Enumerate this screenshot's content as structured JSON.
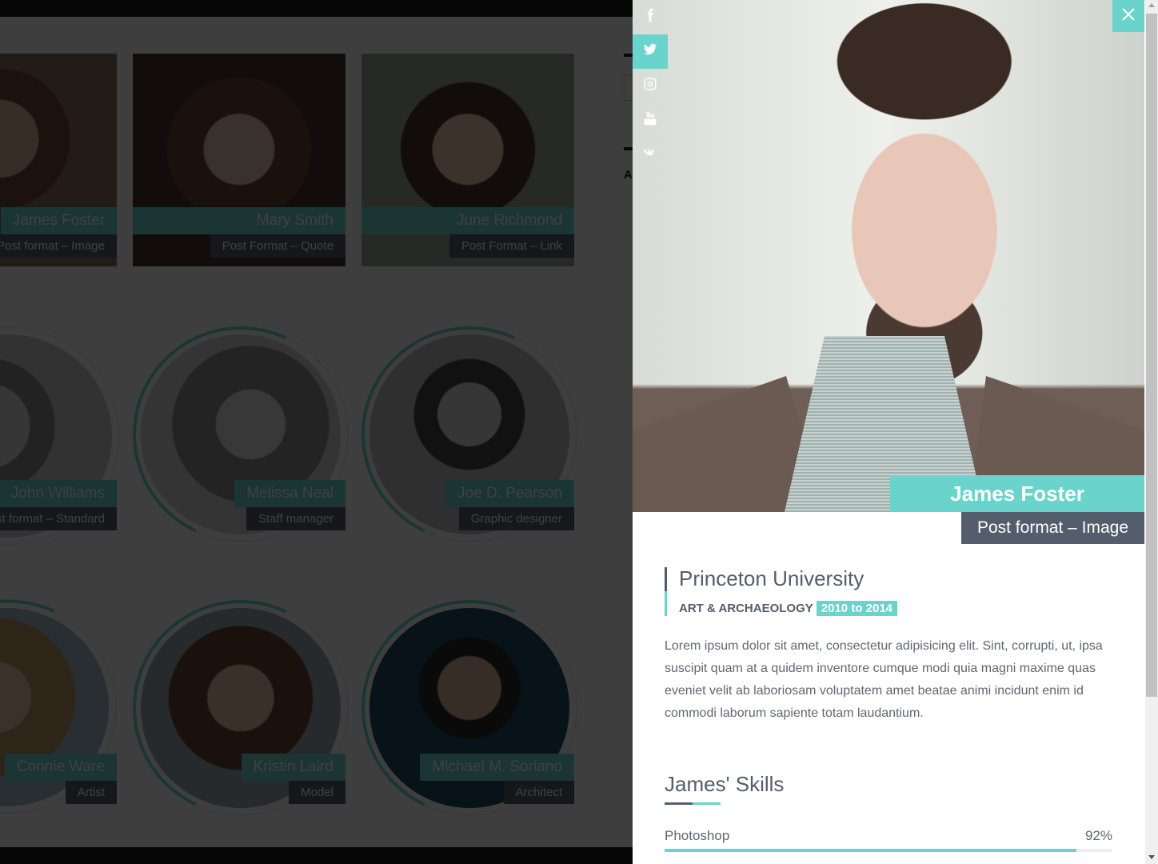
{
  "background_page": {
    "cards": [
      {
        "name": "James Foster",
        "role": "Post format – Image",
        "shape": "square"
      },
      {
        "name": "Mary Smith",
        "role": "Post Format – Quote",
        "shape": "square"
      },
      {
        "name": "June Richmond",
        "role": "Post Format – Link",
        "shape": "square"
      },
      {
        "name": "John Williams",
        "role": "Post format – Standard",
        "shape": "round"
      },
      {
        "name": "Melissa Neal",
        "role": "Staff manager",
        "shape": "round"
      },
      {
        "name": "Joe D. Pearson",
        "role": "Graphic designer",
        "shape": "round"
      },
      {
        "name": "Connie Ware",
        "role": "Artist",
        "shape": "round"
      },
      {
        "name": "Kristin Laird",
        "role": "Model",
        "shape": "round"
      },
      {
        "name": "Michael M. Soriano",
        "role": "Architect",
        "shape": "round"
      }
    ],
    "sidebar_letter": "A"
  },
  "panel": {
    "social": [
      {
        "icon": "facebook-icon",
        "glyph": "f",
        "active": false
      },
      {
        "icon": "twitter-icon",
        "glyph": "",
        "active": true
      },
      {
        "icon": "instagram-icon",
        "glyph": "",
        "active": false
      },
      {
        "icon": "youtube-icon",
        "glyph": "You Tube",
        "active": false
      },
      {
        "icon": "vk-icon",
        "glyph": "vk",
        "active": false
      }
    ],
    "close_icon": "close-icon",
    "name": "James Foster",
    "role": "Post format – Image",
    "education": {
      "school": "Princeton University",
      "field": "ART & ARCHAEOLOGY",
      "years": "2010 to 2014"
    },
    "bio": "Lorem ipsum dolor sit amet, consectetur adipisicing elit. Sint, corrupti, ut, ipsa suscipit quam at a quidem inventore cumque modi quia magni maxime quas eveniet velit ab laboriosam voluptatem amet beatae animi incidunt enim id commodi laborum sapiente totam laudantium.",
    "skills_title": "James' Skills",
    "skills": [
      {
        "label": "Photoshop",
        "percent_label": "92%",
        "value": 92
      }
    ]
  },
  "colors": {
    "accent": "#6ad4cc",
    "dark": "#535d6b"
  }
}
